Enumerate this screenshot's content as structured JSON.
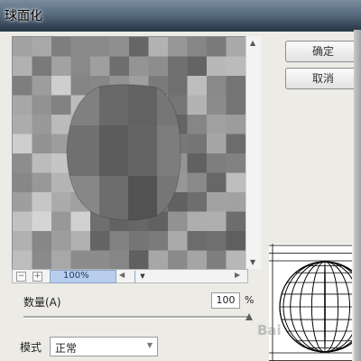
{
  "dialog": {
    "title": "球面化",
    "ok_label": "确定",
    "cancel_label": "取消"
  },
  "preview": {
    "zoom_level": "100%",
    "zoom_out_label": "−",
    "zoom_in_label": "+"
  },
  "amount": {
    "label": "数量(A)",
    "value": "100",
    "unit": "%",
    "slider_fraction": 1.0
  },
  "mode": {
    "label": "模式",
    "selected": "正常"
  },
  "watermark": {
    "text": "Bai"
  },
  "icons": {
    "zoom_out": "minus-icon",
    "zoom_in": "plus-icon",
    "dropdown": "chevron-down-icon",
    "scroll_up": "triangle-up-icon",
    "scroll_down": "triangle-down-icon",
    "scroll_left": "triangle-left-icon",
    "scroll_right": "triangle-right-icon"
  },
  "colors": {
    "titlebar_top": "#7a8c9e",
    "titlebar_bottom": "#2c3a4a",
    "zoom_field": "#b9ceec",
    "dialog_bg": "#ecebe6"
  }
}
